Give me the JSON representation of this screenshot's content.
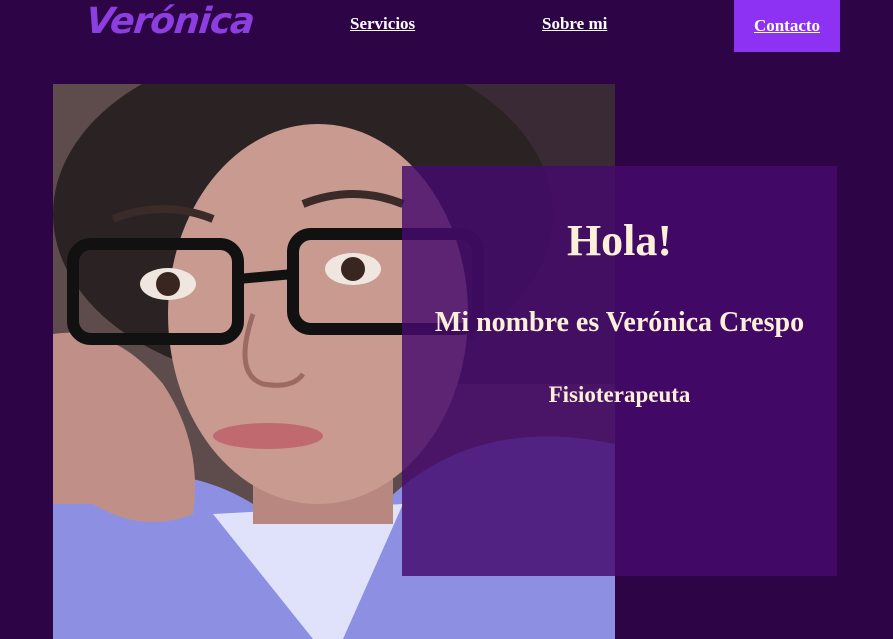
{
  "header": {
    "logo": "Verónica",
    "nav": {
      "servicios": "Servicios",
      "sobre_mi": "Sobre mi",
      "contacto": "Contacto"
    }
  },
  "hero": {
    "greeting": "Hola!",
    "name_line": "Mi nombre es Verónica Crespo",
    "profession": "Fisioterapeuta"
  },
  "colors": {
    "background": "#2d0446",
    "brand": "#8c3ee0",
    "contact_button": "#8d32f2",
    "card_overlay": "#460a6e",
    "heading_text": "#fdf0d8"
  }
}
